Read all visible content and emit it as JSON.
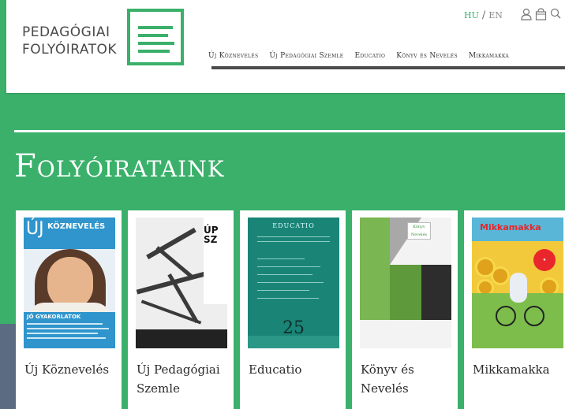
{
  "brand": {
    "line1": "PEDAGÓGIAI",
    "line2": "FOLYÓIRATOK"
  },
  "lang": {
    "hu": "HU",
    "en": "EN",
    "separator": "/"
  },
  "nav": {
    "items": [
      "Új Köznevelés",
      "Új Pedagógiai Szemle",
      "Educatio",
      "Könyv és Nevelés",
      "Mikkamakka"
    ]
  },
  "title": "Folyóirataink",
  "journals": [
    {
      "label": "Új Köznevelés",
      "cover_title": "ÚJ",
      "cover_subtitle": "KÖZNEVELÉS",
      "cover_band": "JÓ GYAKORLATOK"
    },
    {
      "label": "Új Pedagógiai Szemle",
      "cover_title": "ÚP SZ"
    },
    {
      "label": "Educatio",
      "cover_title": "EDUCATIO",
      "cover_number": "25"
    },
    {
      "label": "Könyv és Nevelés",
      "cover_title": "Könyv Nevelés"
    },
    {
      "label": "Mikkamakka",
      "cover_title": "Mikkamakka"
    }
  ],
  "colors": {
    "accent": "#3ab06a",
    "header_bg": "#ffffff",
    "nav_text": "#333333"
  }
}
